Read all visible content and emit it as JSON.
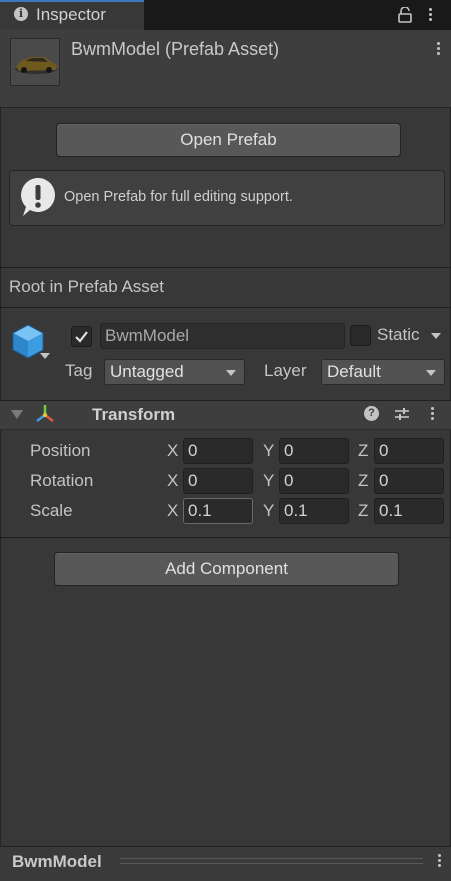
{
  "tab": {
    "label": "Inspector"
  },
  "header": {
    "title": "BwmModel (Prefab Asset)"
  },
  "open_prefab": {
    "label": "Open Prefab"
  },
  "helpbox": {
    "text": "Open Prefab for full editing support."
  },
  "root": {
    "label": "Root in Prefab Asset"
  },
  "game_object": {
    "name": "BwmModel",
    "active": true,
    "static_label": "Static",
    "static": false,
    "tag_label": "Tag",
    "tag_value": "Untagged",
    "layer_label": "Layer",
    "layer_value": "Default"
  },
  "transform": {
    "title": "Transform",
    "rows": [
      {
        "label": "Position",
        "x": "0",
        "y": "0",
        "z": "0"
      },
      {
        "label": "Rotation",
        "x": "0",
        "y": "0",
        "z": "0"
      },
      {
        "label": "Scale",
        "x": "0.1",
        "y": "0.1",
        "z": "0.1"
      }
    ],
    "axis": {
      "x": "X",
      "y": "Y",
      "z": "Z"
    }
  },
  "add_component": {
    "label": "Add Component"
  },
  "footer": {
    "label": "BwmModel"
  },
  "colors": {
    "accent": "#3a79bb",
    "panel": "#383838",
    "field": "#2a2a2a",
    "button": "#585858"
  }
}
